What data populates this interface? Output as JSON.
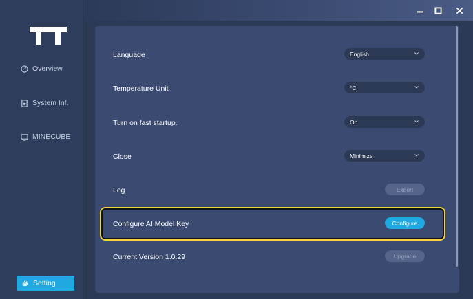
{
  "sidebar": {
    "logo": "TT",
    "items": [
      {
        "label": "Overview",
        "icon": "gauge-icon"
      },
      {
        "label": "System Inf.",
        "icon": "document-icon"
      },
      {
        "label": "MINECUBE",
        "icon": "monitor-icon"
      }
    ],
    "active": {
      "label": "Setting",
      "icon": "gear-icon"
    }
  },
  "titlebar": {
    "minimize": "–",
    "maximize": "□",
    "close": "✕"
  },
  "settings": {
    "language": {
      "label": "Language",
      "value": "English"
    },
    "temperature": {
      "label": "Temperature Unit",
      "value": "°C"
    },
    "fast_startup": {
      "label": "Turn on fast startup.",
      "value": "On"
    },
    "close": {
      "label": "Close",
      "value": "Minimize"
    },
    "log": {
      "label": "Log",
      "button": "Export"
    },
    "ai_key": {
      "label": "Configure AI Model Key",
      "button": "Configure"
    },
    "version": {
      "label": "Current Version 1.0.29",
      "button": "Upgrade"
    }
  },
  "colors": {
    "accent": "#20a9e0",
    "highlight": "#f2d43c",
    "sidebar": "#2e3d5c",
    "panel": "#3b4a71"
  }
}
